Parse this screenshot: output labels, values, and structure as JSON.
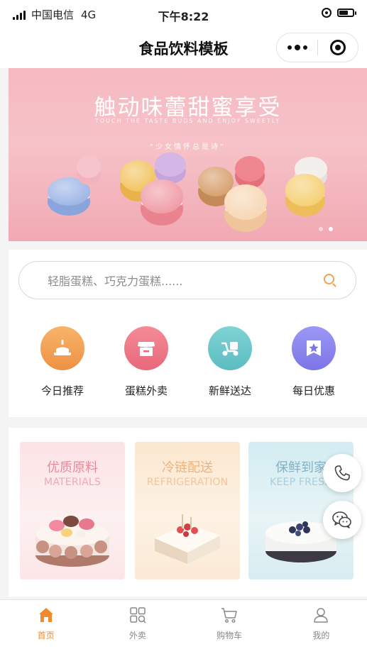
{
  "status_bar": {
    "carrier": "中国电信",
    "network": "4G",
    "time": "下午8:22"
  },
  "nav": {
    "title": "食品饮料模板"
  },
  "banner": {
    "title": "触动味蕾甜蜜享受",
    "subtitle": "TOUCH THE TASTE BUDS AND ENJOY SWEETLY",
    "tagline": "“少女情怀总是诗”",
    "active_slide": 2,
    "slide_count": 2
  },
  "search": {
    "placeholder": "轻脂蛋糕、巧克力蛋糕......"
  },
  "categories": [
    {
      "label": "今日推荐",
      "icon": "cake-candle-icon",
      "color": "#f0a04e"
    },
    {
      "label": "蛋糕外卖",
      "icon": "shop-icon",
      "color": "#ef7c8a"
    },
    {
      "label": "新鲜送达",
      "icon": "delivery-scooter-icon",
      "color": "#6cc7c9"
    },
    {
      "label": "每日优惠",
      "icon": "star-badge-icon",
      "color": "#8a86f0"
    }
  ],
  "features": [
    {
      "title": "优质原料",
      "subtitle": "MATERIALS",
      "color": "#e98a9a"
    },
    {
      "title": "冷链配送",
      "subtitle": "REFRIGERATION",
      "color": "#efb27e"
    },
    {
      "title": "保鲜到家",
      "subtitle": "KEEP FRESH",
      "color": "#7fb2c9"
    }
  ],
  "floating": {
    "phone_icon": "phone-icon",
    "chat_icon": "wechat-icon"
  },
  "tabs": [
    {
      "label": "首页",
      "icon": "home-icon",
      "active": true
    },
    {
      "label": "外卖",
      "icon": "grid-icon",
      "active": false
    },
    {
      "label": "购物车",
      "icon": "cart-icon",
      "active": false
    },
    {
      "label": "我的",
      "icon": "user-icon",
      "active": false
    }
  ],
  "colors": {
    "accent": "#f08a2c",
    "banner_bg": "#f6bcc4"
  }
}
